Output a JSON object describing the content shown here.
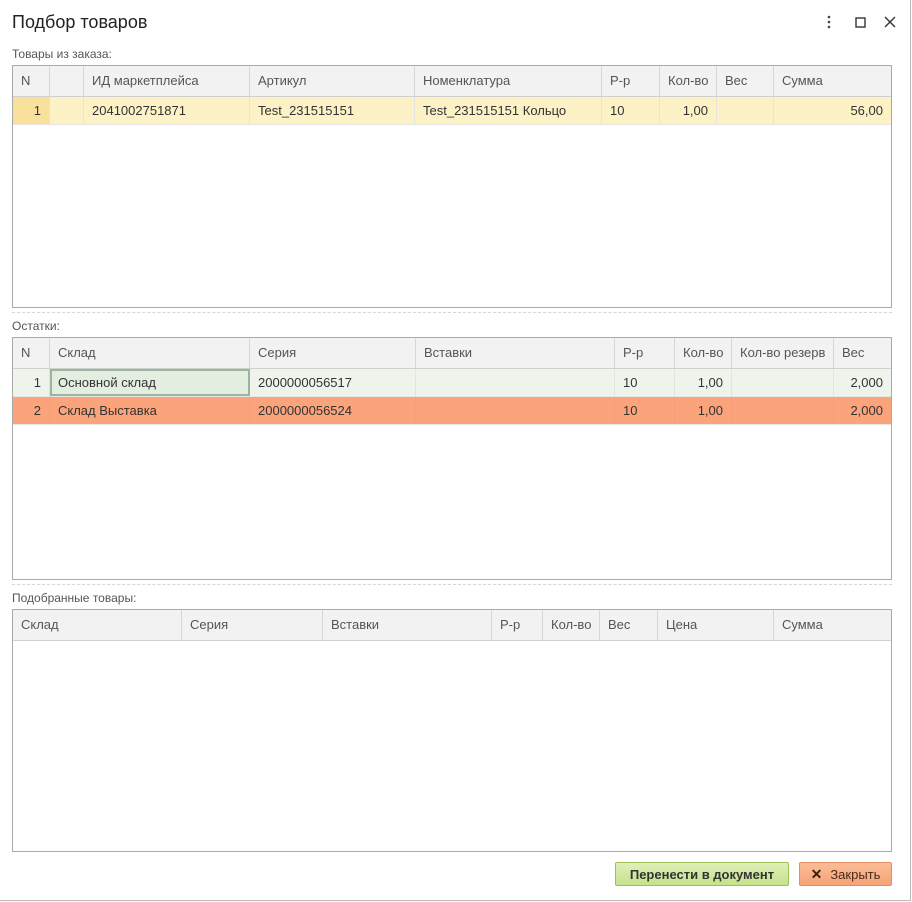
{
  "window": {
    "title": "Подбор товаров"
  },
  "order_items": {
    "label": "Товары из заказа:",
    "columns": [
      "N",
      "",
      "ИД маркетплейса",
      "Артикул",
      "Номенклатура",
      "Р-р",
      "Кол-во",
      "Вес",
      "Сумма"
    ],
    "rows": [
      [
        "1",
        "",
        "2041002751871",
        "Test_231515151",
        "Test_231515151 Кольцо",
        "10",
        "1,00",
        "",
        "56,00"
      ]
    ]
  },
  "stock": {
    "label": "Остатки:",
    "columns": [
      "N",
      "Склад",
      "Серия",
      "Вставки",
      "Р-р",
      "Кол-во",
      "Кол-во резерв",
      "Вес"
    ],
    "rows": [
      [
        "1",
        "Основной склад",
        "2000000056517",
        "",
        "10",
        "1,00",
        "",
        "2,000"
      ],
      [
        "2",
        "Склад Выставка",
        "2000000056524",
        "",
        "10",
        "1,00",
        "",
        "2,000"
      ]
    ]
  },
  "selected": {
    "label": "Подобранные товары:",
    "columns": [
      "Склад",
      "Серия",
      "Вставки",
      "Р-р",
      "Кол-во",
      "Вес",
      "Цена",
      "Сумма"
    ],
    "rows": []
  },
  "buttons": {
    "transfer": "Перенести в документ",
    "close": "Закрыть"
  },
  "colors": {
    "selected_row": "#fcf2c6",
    "highlight_row": "#fba37a",
    "primary_button": "#c6e18b",
    "close_button": "#f5a377"
  }
}
